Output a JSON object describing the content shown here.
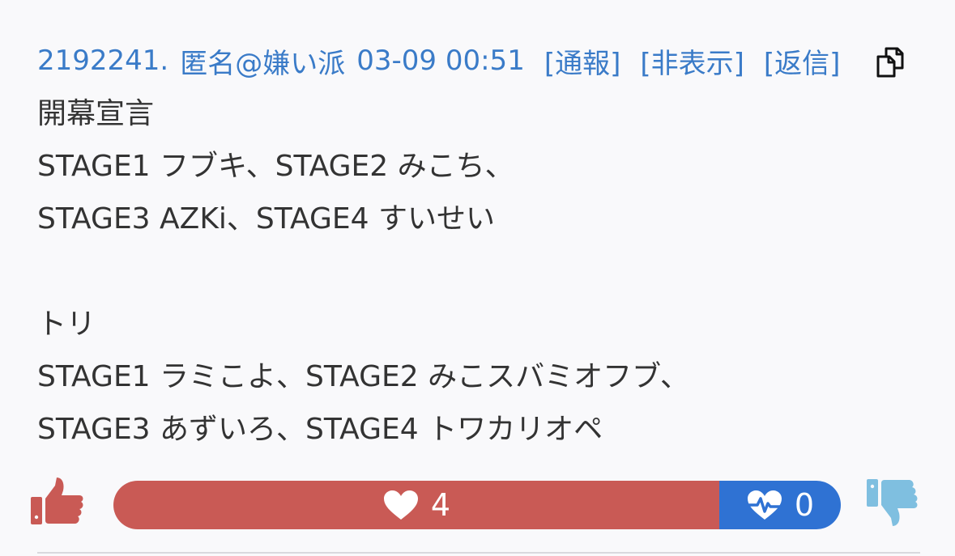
{
  "post": {
    "number": "2192241.",
    "author": "匿名@嫌い派",
    "timestamp": "03-09 00:51",
    "actions": {
      "report": "[通報]",
      "hide": "[非表示]",
      "reply": "[返信]"
    },
    "copy_icon": "copy-icon",
    "lines": [
      "開幕宣言",
      "STAGE1 フブキ、STAGE2 みこち、",
      "STAGE3 AZKi、STAGE4 すいせい",
      "",
      "トリ",
      "STAGE1 ラミこよ、STAGE2 みこスバミオフブ、",
      "STAGE3 あずいろ、STAGE4 トワカリオペ"
    ]
  },
  "votes": {
    "likes": "4",
    "dislikes": "0",
    "like_fraction": 1.0,
    "like_icon": "heart-icon",
    "dislike_icon": "heartbeat-icon",
    "up_icon": "thumbs-up-icon",
    "down_icon": "thumbs-down-icon"
  },
  "colors": {
    "link": "#3a7bc8",
    "like": "#c95a55",
    "dislike": "#2f72d3",
    "thumb_down": "#7fbfe0",
    "text": "#333333"
  }
}
